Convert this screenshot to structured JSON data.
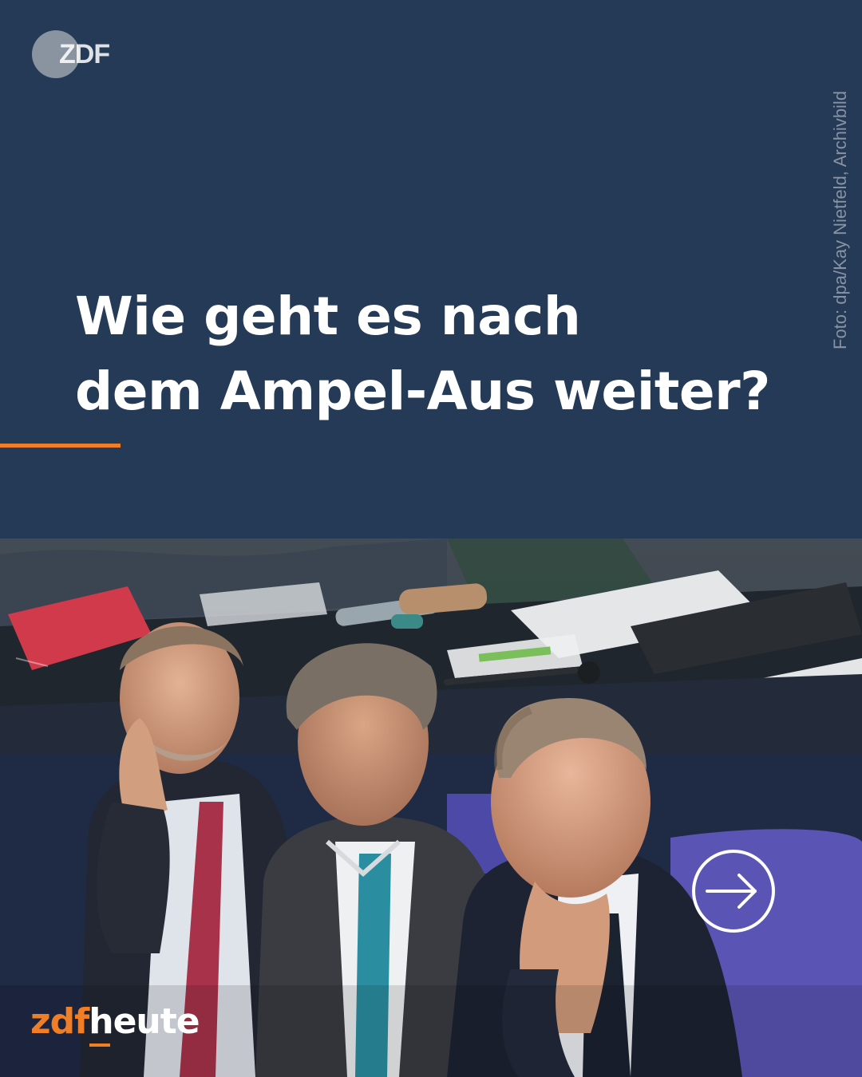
{
  "brand": {
    "top_logo": "ZDF",
    "bottom_logo_prefix": "zdf",
    "bottom_logo_suffix": "heute"
  },
  "headline": {
    "line1": "Wie geht es nach",
    "line2": "dem Ampel-Aus weiter?"
  },
  "photo_credit": "Foto: dpa/Kay Nietfeld, Archivbild",
  "colors": {
    "background": "#243a56",
    "accent": "#f07e26",
    "text": "#ffffff"
  },
  "icons": {
    "next": "arrow-right-circle-icon",
    "logo_mark": "zdf-circle-icon"
  }
}
